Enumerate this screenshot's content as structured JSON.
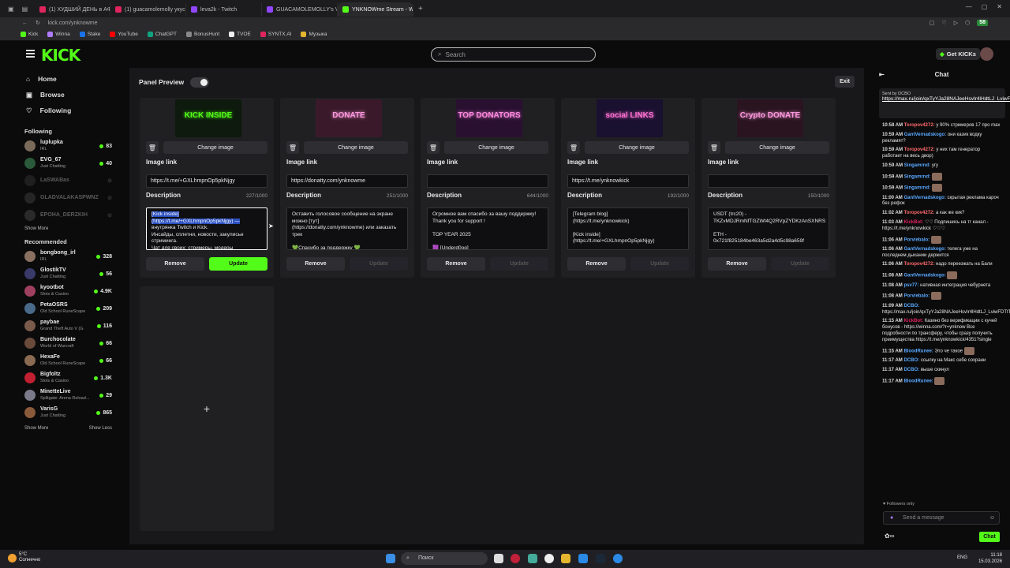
{
  "browser": {
    "tabs": [
      {
        "label": "(1) ХУДШИЙ ДЕНЬ в АФИ",
        "color": "#e0245e"
      },
      {
        "label": "(1) guacamolemolly укус",
        "color": "#e0245e"
      },
      {
        "label": "leva2k - Twitch",
        "color": "#9146ff"
      },
      {
        "label": "GUACAMOLEMOLLY's Vi",
        "color": "#9146ff"
      },
      {
        "label": "YNKNOWme Stream - We",
        "color": "#53fc18"
      }
    ],
    "url": "kick.com/ynknowme",
    "bookmarks": [
      "Kick",
      "Winna",
      "Stake",
      "YouTube",
      "ChatGPT",
      "BonusHunt",
      "TVOE",
      "SYNTX.AI",
      "Музыка"
    ],
    "ext_badge": "58"
  },
  "header": {
    "logo": "KICK",
    "search_placeholder": "Search",
    "get_kicks": "Get KICKs"
  },
  "sidebar": {
    "nav": [
      {
        "label": "Home",
        "icon": "home-icon"
      },
      {
        "label": "Browse",
        "icon": "browse-icon"
      },
      {
        "label": "Following",
        "icon": "heart-icon"
      }
    ],
    "following_title": "Following",
    "following": [
      {
        "name": "luplupka",
        "cat": "IRL",
        "viewers": "83",
        "live": true
      },
      {
        "name": "EVG_67",
        "cat": "Just Chatting",
        "viewers": "40",
        "live": true
      },
      {
        "name": "LaSWABas",
        "cat": "",
        "viewers": "",
        "live": false
      },
      {
        "name": "GLADVALAKASPWNZ",
        "cat": "",
        "viewers": "",
        "live": false
      },
      {
        "name": "EPOHA_DERZKIH",
        "cat": "",
        "viewers": "",
        "live": false
      }
    ],
    "show_more": "Show More",
    "recommended_title": "Recommended",
    "recommended": [
      {
        "name": "bongbong_irl",
        "cat": "IRL",
        "viewers": "328"
      },
      {
        "name": "GlostikTV",
        "cat": "Just Chatting",
        "viewers": "56"
      },
      {
        "name": "kyootbot",
        "cat": "Slots & Casino",
        "viewers": "4.9K"
      },
      {
        "name": "PetaOSRS",
        "cat": "Old School RuneScape",
        "viewers": "209"
      },
      {
        "name": "paybae",
        "cat": "Grand Theft Auto V (G",
        "viewers": "116"
      },
      {
        "name": "Burchocolate",
        "cat": "World of Warcraft",
        "viewers": "66"
      },
      {
        "name": "HexaFe",
        "cat": "Old School RuneScape",
        "viewers": "66"
      },
      {
        "name": "Bigfoltz",
        "cat": "Slots & Casino",
        "viewers": "1.3K"
      },
      {
        "name": "MinetteLive",
        "cat": "Splitgate: Arena Reload...",
        "viewers": "29"
      },
      {
        "name": "VarisG",
        "cat": "Just Chatting",
        "viewers": "865"
      }
    ],
    "show_more2": "Show More",
    "show_less": "Show Less"
  },
  "panels_header": {
    "title": "Panel Preview",
    "exit": "Exit"
  },
  "panels": [
    {
      "img_text": "KICK INSIDE",
      "img_bg": "#0d1a0d",
      "img_color": "#53fc18",
      "change": "Change image",
      "link_label": "Image link",
      "link": "https://t.me/+GXLhmpnOp5pkNjgy",
      "desc_label": "Description",
      "count": "227/1000",
      "desc_hl": "[Kick inside]\n(https://t.me/+GXLhmpnOp5pkNjgy) —",
      "desc": "\nвнутрянка Twitch и Kick.\nИнсайды, сплетни, новости, закулисье стриминга.\nЧат для своих: стримеры, модеры",
      "remove": "Remove",
      "update": "Update",
      "update_on": true
    },
    {
      "img_text": "DONATE",
      "img_bg": "#3a1a2a",
      "img_color": "#ff9adf",
      "change": "Change image",
      "link_label": "Image link",
      "link": "https://donatty.com/ynknowme",
      "desc_label": "Description",
      "count": "251/1000",
      "desc_hl": "",
      "desc": "Оставить голосовое сообщение на экране можно [тут]\n(https://donatty.com/ynknowme) или заказать трек\n\n💚Спасибо за поддержку 💚",
      "remove": "Remove",
      "update": "Update",
      "update_on": false
    },
    {
      "img_text": "TOP DONATORS",
      "img_bg": "#2a1030",
      "img_color": "#ff8ae0",
      "change": "Change image",
      "link_label": "Image link",
      "link": "",
      "desc_label": "Description",
      "count": "644/1000",
      "desc_hl": "",
      "desc": "Огромное вам спасибо за вашу поддержку! Thank you for support !\n\nTOP YEAR 2025\n\n🟪 [Underd0og]",
      "remove": "Remove",
      "update": "Update",
      "update_on": false
    },
    {
      "img_text": "social LINKS",
      "img_bg": "#1a1030",
      "img_color": "#ff70d0",
      "change": "Change image",
      "link_label": "Image link",
      "link": "https://t.me/ynknowkick",
      "desc_label": "Description",
      "count": "192/1000",
      "desc_hl": "",
      "desc": "[Telegram blog]\n(https://t.me/ynknowkick)\n\n[Kick inside]\n(https://t.me/+GXLhmpnOp5pkNjgy)",
      "remove": "Remove",
      "update": "Update",
      "update_on": false
    },
    {
      "img_text": "Crypto DONATE",
      "img_bg": "#2a1420",
      "img_color": "#ff9adf",
      "change": "Change image",
      "link_label": "Image link",
      "link": "",
      "desc_label": "Description",
      "count": "150/1000",
      "desc_hl": "",
      "desc": "USDT (trc20) - TKZvMDJRmNfTGZWt4Q2RVpZYDKzAnSXNRS\n\nETH -\n0x721f825184be463a5d2a4d5c98a659f",
      "remove": "Remove",
      "update": "Update",
      "update_on": false
    }
  ],
  "add_panel": "+",
  "chat": {
    "title": "Chat",
    "pinned_by": "Sent by DCBO",
    "pinned_link": "https://max.ru/join/qxTyYJa28NAJeeHsvIr4lHdtLJ_LviwFDTtTrto5nOs",
    "messages": [
      {
        "t": "10:58 AM",
        "u": "Toropov4272:",
        "c": "#ff6b6b",
        "m": "у 90% стримеров 17 про max"
      },
      {
        "t": "10:59 AM",
        "u": "GantVernadskogo:",
        "c": "#5aa9ff",
        "m": "они казик водку рекламят?"
      },
      {
        "t": "10:59 AM",
        "u": "Toropov4272:",
        "c": "#ff6b6b",
        "m": "у них там генератор работает на весь двор)"
      },
      {
        "t": "10:59 AM",
        "u": "Singamrnd:",
        "c": "#5aa9ff",
        "m": "угу"
      },
      {
        "t": "10:59 AM",
        "u": "Singamrnd:",
        "c": "#5aa9ff",
        "m": "",
        "emote": true
      },
      {
        "t": "10:59 AM",
        "u": "Singamrnd:",
        "c": "#5aa9ff",
        "m": "",
        "emote": true
      },
      {
        "t": "11:00 AM",
        "u": "GantVernadskogo:",
        "c": "#5aa9ff",
        "m": "скрытая реклама кароч без рефок"
      },
      {
        "t": "11:02 AM",
        "u": "Toropov4272:",
        "c": "#ff6b6b",
        "m": "а как же кик?"
      },
      {
        "t": "11:03 AM",
        "u": "KickBot:",
        "c": "#e0245e",
        "m": "♡♡ Подпишись на тг канал - https://t.me/ynknowkick ♡♡♡"
      },
      {
        "t": "11:06 AM",
        "u": "Porviebalo:",
        "c": "#5aa9ff",
        "m": "",
        "emote": true
      },
      {
        "t": "11:06 AM",
        "u": "GantVernadskogo:",
        "c": "#5aa9ff",
        "m": "телега уже на последнем дыхании держится"
      },
      {
        "t": "11:06 AM",
        "u": "Toropov4272:",
        "c": "#ff6b6b",
        "m": "надо переезжать на Бали"
      },
      {
        "t": "11:08 AM",
        "u": "GantVernadskogo:",
        "c": "#5aa9ff",
        "m": "",
        "emote": true
      },
      {
        "t": "11:08 AM",
        "u": "psv77:",
        "c": "#5aa9ff",
        "m": "нативная интеграция чебурнета"
      },
      {
        "t": "11:08 AM",
        "u": "Porviebalo:",
        "c": "#5aa9ff",
        "m": "",
        "emote": true
      },
      {
        "t": "11:09 AM",
        "u": "DCBO:",
        "c": "#5aa9ff",
        "m": "https://max.ru/join/qxTyYJa28NAJeeHsvIr4lHdtLJ_LviwFDTtTrto5nOs"
      },
      {
        "t": "11:15 AM",
        "u": "KickBot:",
        "c": "#e0245e",
        "m": "Казино без верификации с кучей бонусов - https://winna.com/?r=ynknow Все подробности по трансферу, чтобы сразу получить преимущества https://t.me/ynknowkick/4351?single"
      },
      {
        "t": "11:15 AM",
        "u": "BloodRunee:",
        "c": "#5aa9ff",
        "m": "Это че такое",
        "emote": true
      },
      {
        "t": "11:17 AM",
        "u": "DCBO:",
        "c": "#5aa9ff",
        "m": "ссылку на Макс себе сохрани"
      },
      {
        "t": "11:17 AM",
        "u": "DCBO:",
        "c": "#5aa9ff",
        "m": "выше скинул"
      },
      {
        "t": "11:17 AM",
        "u": "BloodRunee:",
        "c": "#5aa9ff",
        "m": "",
        "emote": true
      }
    ],
    "followers_only": "Followers only",
    "input_placeholder": "Send a message",
    "send": "Chat"
  },
  "taskbar": {
    "temp": "5°C",
    "weather": "Солнечно",
    "search": "Поиск",
    "lang": "ENG",
    "time": "11:18",
    "date": "15.03.2026"
  }
}
